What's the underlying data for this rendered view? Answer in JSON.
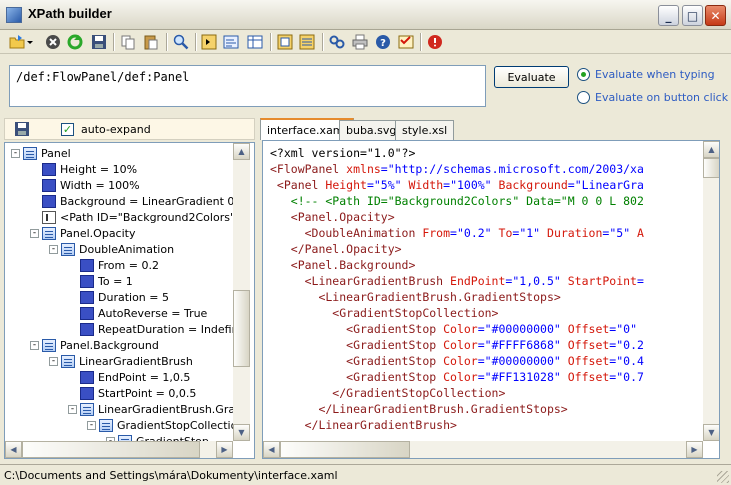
{
  "window": {
    "title": "XPath builder"
  },
  "toolbar": {
    "icons": [
      "open-icon",
      "dropdown-arrow-icon",
      "stop-icon",
      "refresh-icon",
      "save-icon",
      "copy-icon",
      "paste-icon",
      "find-icon",
      "node-icon",
      "xpath-icon",
      "table-icon",
      "grid-icon",
      "list-icon",
      "link-icon",
      "print-icon",
      "help-icon",
      "settings-icon",
      "close-icon"
    ]
  },
  "xpath": {
    "expression": "/def:FlowPanel/def:Panel",
    "evaluate_label": "Evaluate",
    "mode_typing": "Evaluate when typing",
    "mode_button": "Evaluate on button click",
    "selected_mode": "typing"
  },
  "left": {
    "auto_expand_label": "auto-expand",
    "auto_expand": true,
    "tree": [
      {
        "depth": 0,
        "type": "elem",
        "exp": "-",
        "label": "Panel"
      },
      {
        "depth": 1,
        "type": "attr",
        "label": "Height = 10%"
      },
      {
        "depth": 1,
        "type": "attr",
        "label": "Width = 100%"
      },
      {
        "depth": 1,
        "type": "attr",
        "label": "Background = LinearGradient 0,0"
      },
      {
        "depth": 1,
        "type": "cmt",
        "label": "<Path ID=\"Background2Colors\" D"
      },
      {
        "depth": 1,
        "type": "elem",
        "exp": "-",
        "label": "Panel.Opacity"
      },
      {
        "depth": 2,
        "type": "elem",
        "exp": "-",
        "label": "DoubleAnimation"
      },
      {
        "depth": 3,
        "type": "attr",
        "label": "From = 0.2"
      },
      {
        "depth": 3,
        "type": "attr",
        "label": "To = 1"
      },
      {
        "depth": 3,
        "type": "attr",
        "label": "Duration = 5"
      },
      {
        "depth": 3,
        "type": "attr",
        "label": "AutoReverse = True"
      },
      {
        "depth": 3,
        "type": "attr",
        "label": "RepeatDuration = Indefinit"
      },
      {
        "depth": 1,
        "type": "elem",
        "exp": "-",
        "label": "Panel.Background"
      },
      {
        "depth": 2,
        "type": "elem",
        "exp": "-",
        "label": "LinearGradientBrush"
      },
      {
        "depth": 3,
        "type": "attr",
        "label": "EndPoint = 1,0.5"
      },
      {
        "depth": 3,
        "type": "attr",
        "label": "StartPoint = 0,0.5"
      },
      {
        "depth": 3,
        "type": "elem",
        "exp": "-",
        "label": "LinearGradientBrush.Grad"
      },
      {
        "depth": 4,
        "type": "elem",
        "exp": "-",
        "label": "GradientStopCollection"
      },
      {
        "depth": 5,
        "type": "elem",
        "exp": "-",
        "label": "GradientStop"
      }
    ]
  },
  "tabs": [
    "interface.xaml",
    "buba.svg",
    "style.xsl"
  ],
  "active_tab": 0,
  "code": [
    [
      [
        "c-proc",
        "<?xml version=\"1.0\"?>"
      ]
    ],
    [
      [
        "c-tag",
        "<FlowPanel "
      ],
      [
        "c-attr",
        "xmlns"
      ],
      [
        "c-punct",
        "="
      ],
      [
        "c-val",
        "\"http://schemas.microsoft.com/2003/xa"
      ]
    ],
    [
      [
        "c-tag",
        " <Panel "
      ],
      [
        "c-attr",
        "Height"
      ],
      [
        "c-punct",
        "="
      ],
      [
        "c-val",
        "\"5%\" "
      ],
      [
        "c-attr",
        "Width"
      ],
      [
        "c-punct",
        "="
      ],
      [
        "c-val",
        "\"100%\" "
      ],
      [
        "c-attr",
        "Background"
      ],
      [
        "c-punct",
        "="
      ],
      [
        "c-val",
        "\"LinearGra"
      ]
    ],
    [
      [
        "c-cmt",
        "   <!-- <Path ID=\"Background2Colors\" Data=\"M 0 0 L 802"
      ]
    ],
    [
      [
        "c-tag",
        "   <Panel.Opacity>"
      ]
    ],
    [
      [
        "c-tag",
        "     <DoubleAnimation "
      ],
      [
        "c-attr",
        "From"
      ],
      [
        "c-punct",
        "="
      ],
      [
        "c-val",
        "\"0.2\" "
      ],
      [
        "c-attr",
        "To"
      ],
      [
        "c-punct",
        "="
      ],
      [
        "c-val",
        "\"1\" "
      ],
      [
        "c-attr",
        "Duration"
      ],
      [
        "c-punct",
        "="
      ],
      [
        "c-val",
        "\"5\" "
      ],
      [
        "c-attr",
        "A"
      ]
    ],
    [
      [
        "c-tag",
        "   </Panel.Opacity>"
      ]
    ],
    [
      [
        "c-tag",
        "   <Panel.Background>"
      ]
    ],
    [
      [
        "c-tag",
        "     <LinearGradientBrush "
      ],
      [
        "c-attr",
        "EndPoint"
      ],
      [
        "c-punct",
        "="
      ],
      [
        "c-val",
        "\"1,0.5\" "
      ],
      [
        "c-attr",
        "StartPoint"
      ],
      [
        "c-punct",
        "="
      ]
    ],
    [
      [
        "c-tag",
        "       <LinearGradientBrush.GradientStops>"
      ]
    ],
    [
      [
        "c-tag",
        "         <GradientStopCollection>"
      ]
    ],
    [
      [
        "c-tag",
        "           <GradientStop "
      ],
      [
        "c-attr",
        "Color"
      ],
      [
        "c-punct",
        "="
      ],
      [
        "c-val",
        "\"#00000000\" "
      ],
      [
        "c-attr",
        "Offset"
      ],
      [
        "c-punct",
        "="
      ],
      [
        "c-val",
        "\"0\""
      ]
    ],
    [
      [
        "c-tag",
        "           <GradientStop "
      ],
      [
        "c-attr",
        "Color"
      ],
      [
        "c-punct",
        "="
      ],
      [
        "c-val",
        "\"#FFFF6868\" "
      ],
      [
        "c-attr",
        "Offset"
      ],
      [
        "c-punct",
        "="
      ],
      [
        "c-val",
        "\"0.2"
      ]
    ],
    [
      [
        "c-tag",
        "           <GradientStop "
      ],
      [
        "c-attr",
        "Color"
      ],
      [
        "c-punct",
        "="
      ],
      [
        "c-val",
        "\"#00000000\" "
      ],
      [
        "c-attr",
        "Offset"
      ],
      [
        "c-punct",
        "="
      ],
      [
        "c-val",
        "\"0.4"
      ]
    ],
    [
      [
        "c-tag",
        "           <GradientStop "
      ],
      [
        "c-attr",
        "Color"
      ],
      [
        "c-punct",
        "="
      ],
      [
        "c-val",
        "\"#FF131028\" "
      ],
      [
        "c-attr",
        "Offset"
      ],
      [
        "c-punct",
        "="
      ],
      [
        "c-val",
        "\"0.7"
      ]
    ],
    [
      [
        "c-tag",
        "         </GradientStopCollection>"
      ]
    ],
    [
      [
        "c-tag",
        "       </LinearGradientBrush.GradientStops>"
      ]
    ],
    [
      [
        "c-tag",
        "     </LinearGradientBrush>"
      ]
    ]
  ],
  "status": {
    "path": "C:\\Documents and Settings\\mára\\Dokumenty\\interface.xaml"
  }
}
